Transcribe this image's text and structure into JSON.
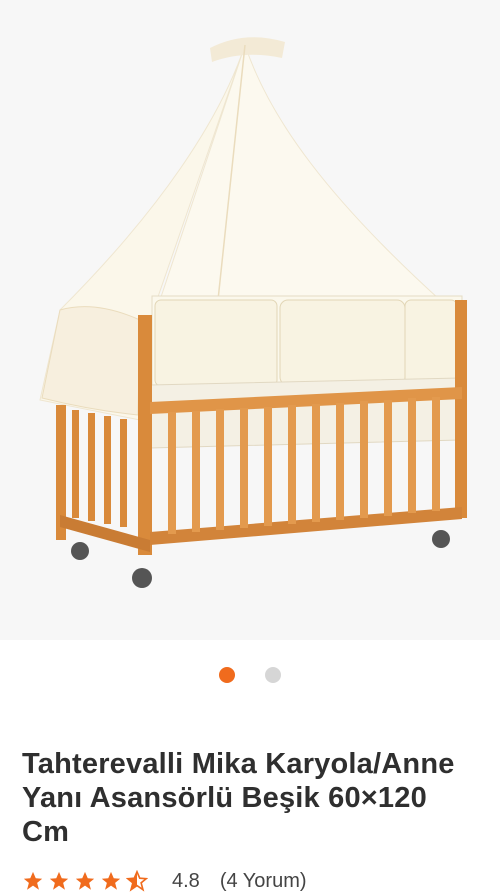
{
  "product": {
    "title": "Tahterevalli Mika Karyola/Anne Yanı Asansörlü Beşik 60×120 Cm",
    "rating": "4.8",
    "reviews": "(4 Yorum)",
    "stars_value": 4.5
  },
  "gallery": {
    "image_icon": "baby-crib-with-canopy",
    "slide_count": 2,
    "active_slide": 1
  },
  "colors": {
    "accent": "#f06b1d",
    "inactive_dot": "#d6d6d6"
  }
}
